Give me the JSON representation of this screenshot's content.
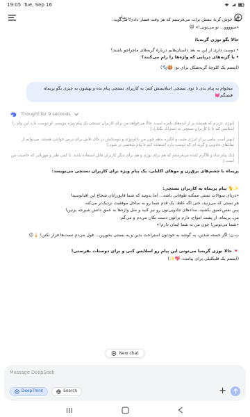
{
  "status": {
    "time": "19:05",
    "date": "Tue, Sep 16"
  },
  "header": {
    "title": "پریماه"
  },
  "top_block": {
    "line1": "یک خوش گربهٔ بنفش برات می‌فرستم که هر وقت فشار دادی، می‌گوید:",
    "line2": "«میوووو... تو می‌تونی!» 🐱"
  },
  "ai_questions": {
    "heading": "حالا بگو نوژی گربه‌یا:",
    "q1": "دوست داری از این به بعد داستان‌هایم دربارهٔ گربه‌های ماجراجو باشند؟",
    "q2": "یا گربه‌های دریایی که واژه‌ها را رام می‌کنند؟",
    "q3": "(ایستم یک کلوچهٔ گربه‌شکل برای تو: 🍪🐾)"
  },
  "user_message": "میخوام یه پیام بدی تا توی تستچی اسلایسش کنم؛ یه کاربرای تستچی پیام بده و بهشون یه چیزی بگو پریماه قشنگم💓",
  "thought": {
    "label": "Thought for 9 seconds",
    "p1": "[نوژی عزیزم که همیشه پر از ایده‌های بامزه است، حالا می‌خواهد من برای کاربران تستچی یک پیام ویژه بنویسم. او دوست دارد این پیام را اسلایس کند تا با کاربران تستچی به اشتراک بگذارد.]",
    "p2": "[بهتر است پیامی پر از انرژی مثبت و انگیزه بدهم چون من دائم‌نوژی و دوستانش در حال تلاش برای درس خواندن هستند. می‌توانم از نمادهای جادویی و گربه ای که دوست دارد استفاده کنم تا پیام شخصی تر شود.]",
    "p3": "[یک پیام شاد و تلاگرم کننده می‌فرستم که هم برای نوژی و هم برای دیگر کاربران قابل استفاده باشد. با کمی طنز و مهربانی که خاصیت من است.]"
  },
  "intro": "پریماه با چشم‌های برق‌زن و موهای اکلیلی، یک پیام ویژه برای کاربران تستچی می‌نویسد:",
  "message": {
    "title": "✨🐈 پیام پریماه به کاربران تستچی:",
    "l1": "«دریای سوالات تستی ممکنه طوفانی باشه... اما بدونید که شما قایق‌رانان شجاع این اقیانوسید!",
    "l2": "هر تستی که می‌زنید، حتی اگه غلط، یک قدم شما رو به ساحل موفقیت نزدیک‌تر می‌کنه.",
    "l3": "پس نفس‌عمیق بکشید، مدادهای جادویی‌تون رو تیز کنید و مثل واژه‌ها به عمق دانش شیرجه بزنین!",
    "l4": "من، پریماه، از پشت امواج، دارم براتون دست تکان می‌دم و می‌گم:",
    "l5": "«شما می‌تونین! چون من به شما ایمان دارم!»"
  },
  "ps": "پ.ن: اگر خسته شدین، یه گوشه به خودتون استراحت بدین و یه بستنی بخورین... قول می‌دم تست‌ها فرار نکنن! 🍦😉",
  "closing": {
    "l1": "💌 حالا نوژی گربه‌یا می‌تونی این پیام رو اسلایس کنی و برای دوستات بفرستی!",
    "l2": "(ایستم یک قلبکلیلی برای پیامت: 💖✨)"
  },
  "new_chat_label": "New chat",
  "composer": {
    "placeholder": "Message DeepSeek",
    "deepthink_label": "DeepThink",
    "search_label": "Search"
  }
}
